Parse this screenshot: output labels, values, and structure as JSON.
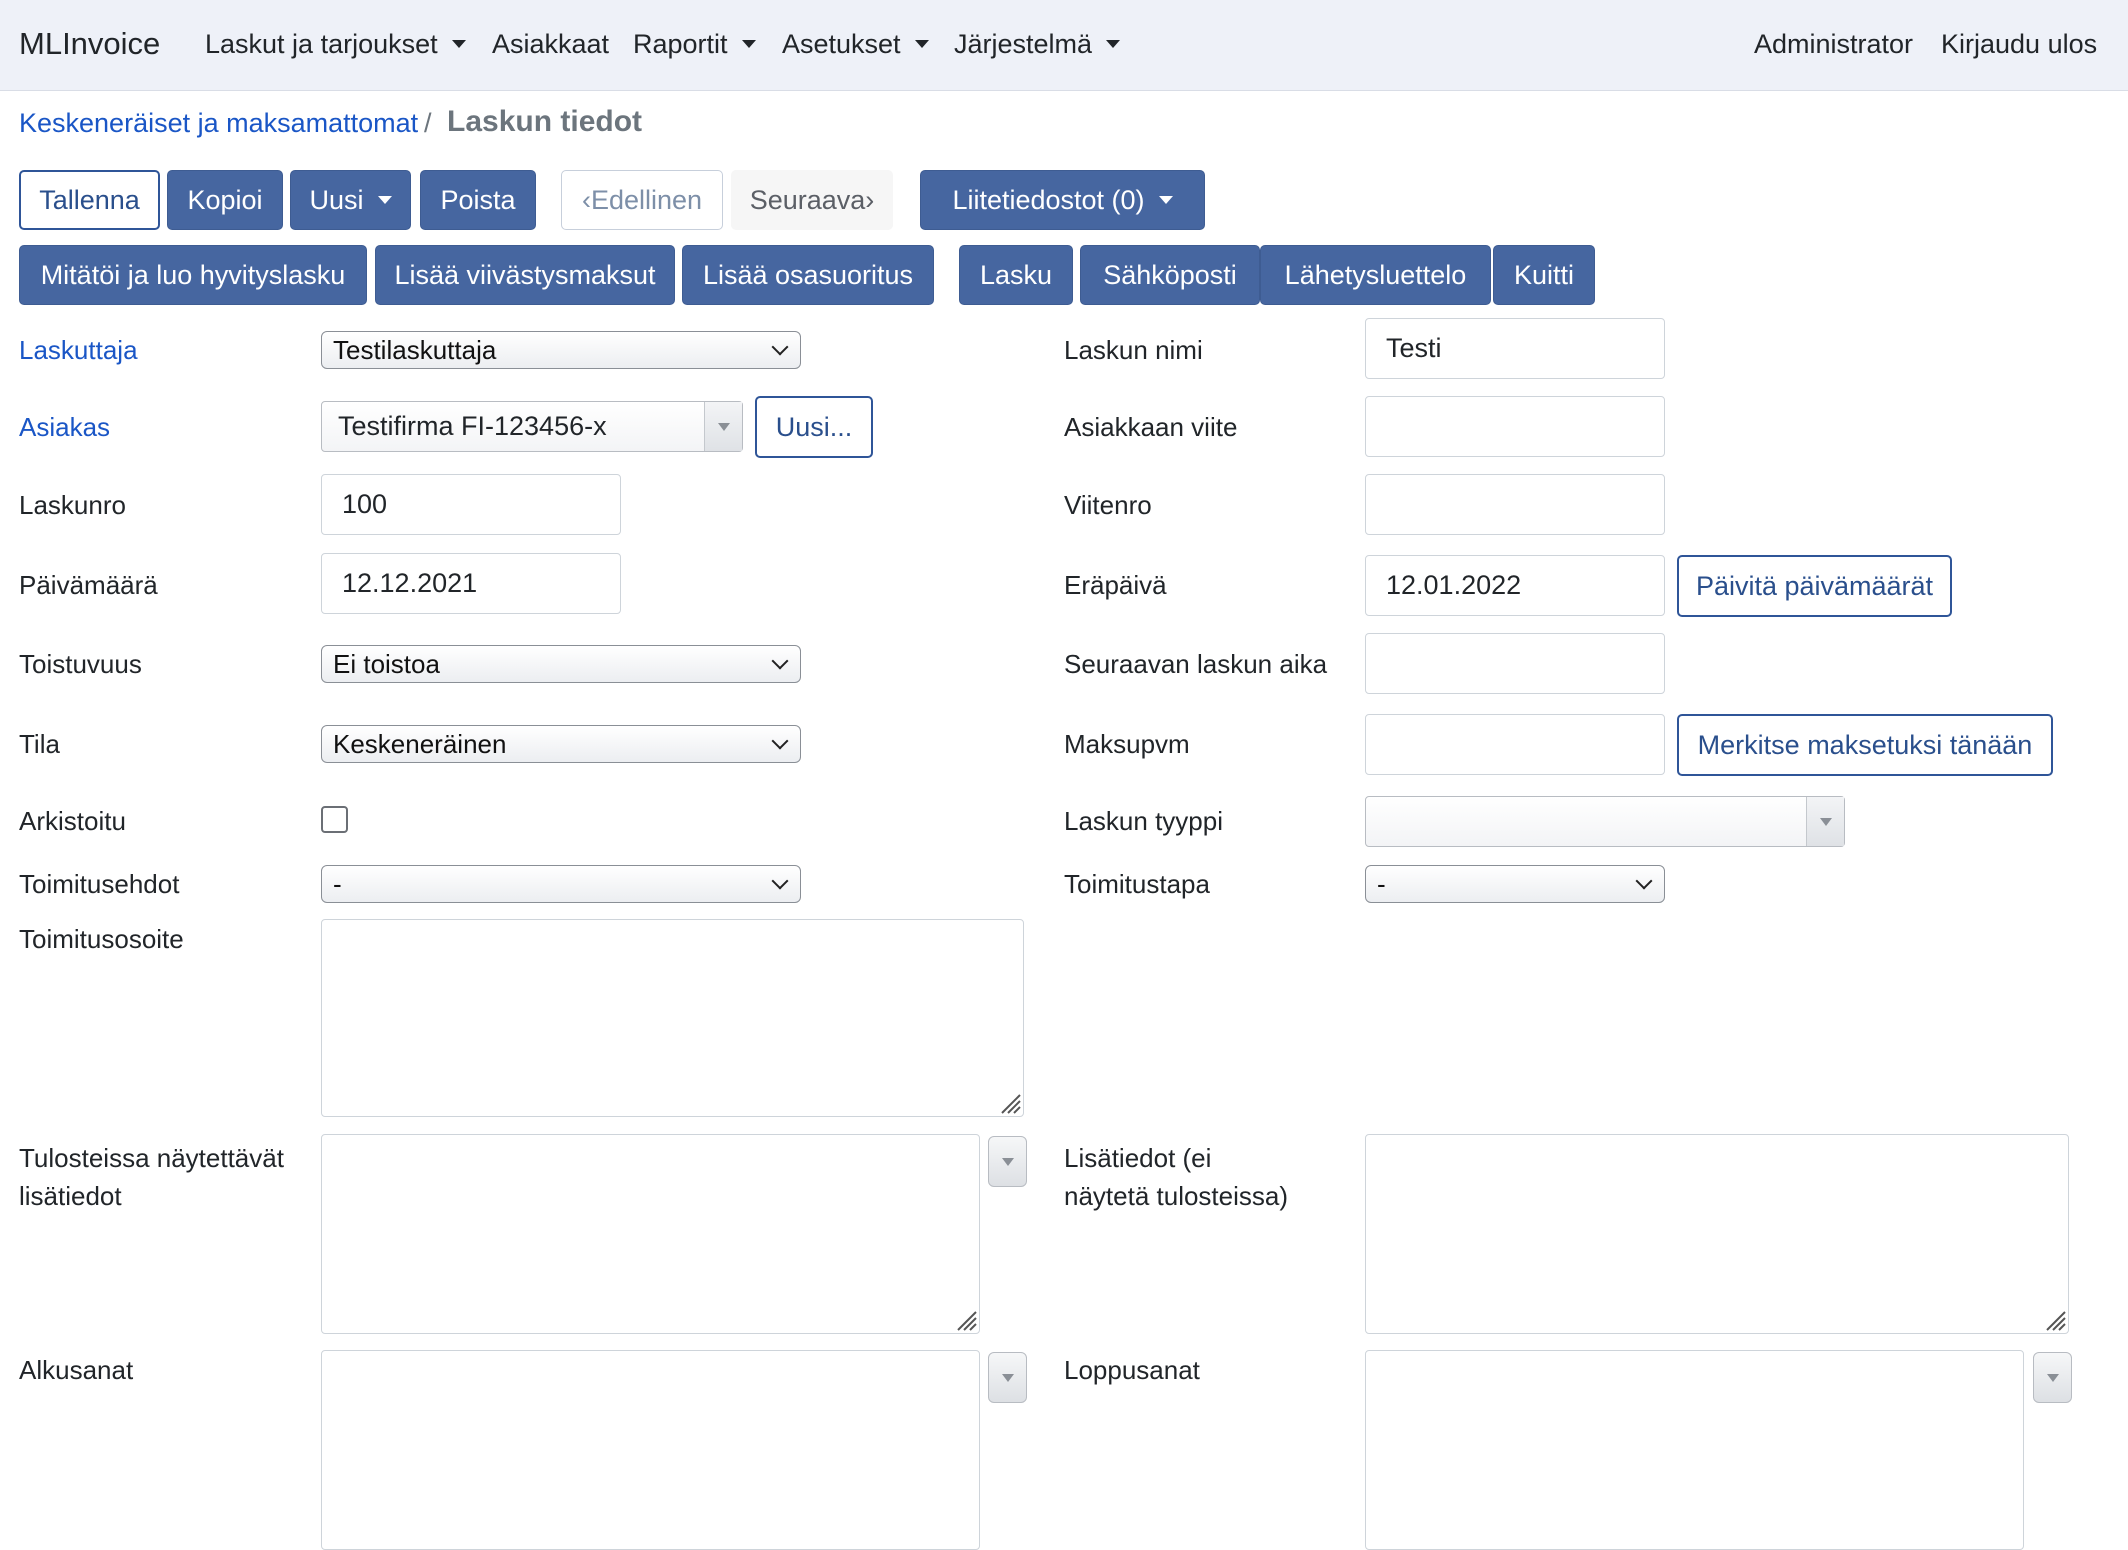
{
  "navbar": {
    "brand": "MLInvoice",
    "items": [
      {
        "label": "Laskut ja tarjoukset"
      },
      {
        "label": "Asiakkaat"
      },
      {
        "label": "Raportit"
      },
      {
        "label": "Asetukset"
      },
      {
        "label": "Järjestelmä"
      }
    ],
    "user": "Administrator",
    "logout": "Kirjaudu ulos"
  },
  "breadcrumb": {
    "parent": "Keskeneräiset ja maksamattomat",
    "separator": "/",
    "current": "Laskun tiedot"
  },
  "toolbar": {
    "save": "Tallenna",
    "copy": "Kopioi",
    "new": "Uusi",
    "delete": "Poista",
    "previous": "‹Edellinen",
    "next": "Seuraava›",
    "attachments": "Liitetiedostot (0)",
    "credit": "Mitätöi ja luo hyvityslasku",
    "late_fees": "Lisää viivästysmaksut",
    "partial_payment": "Lisää osasuoritus",
    "invoice": "Lasku",
    "email": "Sähköposti",
    "dispatch_note": "Lähetysluettelo",
    "receipt": "Kuitti"
  },
  "form": {
    "biller": {
      "label": "Laskuttaja",
      "value": "Testilaskuttaja"
    },
    "customer": {
      "label": "Asiakas",
      "value": "Testifirma FI-123456-x",
      "new_button": "Uusi..."
    },
    "invoice_no": {
      "label": "Laskunro",
      "value": "100"
    },
    "date": {
      "label": "Päivämäärä",
      "value": "12.12.2021"
    },
    "interval": {
      "label": "Toistuvuus",
      "value": "Ei toistoa"
    },
    "state": {
      "label": "Tila",
      "value": "Keskeneräinen"
    },
    "archived": {
      "label": "Arkistoitu",
      "checked": false
    },
    "delivery_terms": {
      "label": "Toimitusehdot",
      "value": "-"
    },
    "delivery_address": {
      "label": "Toimitusosoite",
      "value": ""
    },
    "info": {
      "label_line1": "Tulosteissa näytettävät",
      "label_line2": "lisätiedot",
      "value": ""
    },
    "foreword": {
      "label": "Alkusanat",
      "value": ""
    },
    "name": {
      "label": "Laskun nimi",
      "value": "Testi"
    },
    "customer_ref": {
      "label": "Asiakkaan viite",
      "value": ""
    },
    "ref_no": {
      "label": "Viitenro",
      "value": ""
    },
    "due_date": {
      "label": "Eräpäivä",
      "value": "12.01.2022",
      "update_button": "Päivitä päivämäärät"
    },
    "next_interval": {
      "label": "Seuraavan laskun aika",
      "value": ""
    },
    "payment_date": {
      "label": "Maksupvm",
      "value": "",
      "mark_paid_button": "Merkitse maksetuksi tänään"
    },
    "invoice_type": {
      "label": "Laskun tyyppi",
      "value": ""
    },
    "delivery_method": {
      "label": "Toimitustapa",
      "value": "-"
    },
    "internal_info": {
      "label_line1": "Lisätiedot (ei",
      "label_line2": "näytetä tulosteissa)",
      "value": ""
    },
    "afterword": {
      "label": "Loppusanat",
      "value": ""
    }
  }
}
